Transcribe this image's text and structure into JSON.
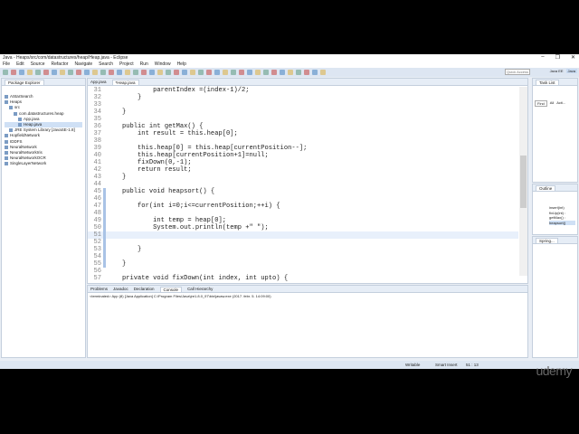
{
  "window": {
    "title": "Java - Heaps/src/com/datastructures/heap/Heap.java - Eclipse",
    "controls": [
      "–",
      "❐",
      "✕"
    ]
  },
  "menu": [
    "File",
    "Edit",
    "Source",
    "Refactor",
    "Navigate",
    "Search",
    "Project",
    "Run",
    "Window",
    "Help"
  ],
  "toolbar": {
    "quick_access": "Quick Access",
    "perspectives": [
      "Java EE",
      "Java"
    ]
  },
  "package_explorer": {
    "title": "Package Explorer",
    "items": [
      {
        "label": "AStarSearch",
        "level": 0
      },
      {
        "label": "Heaps",
        "level": 0
      },
      {
        "label": "src",
        "level": 1
      },
      {
        "label": "com.datastructures.heap",
        "level": 2
      },
      {
        "label": "App.java",
        "level": 3
      },
      {
        "label": "Heap.java",
        "level": 3
      },
      {
        "label": "JRE System Library [JavaSE-1.8]",
        "level": 1
      },
      {
        "label": "HopfieldNetwork",
        "level": 0
      },
      {
        "label": "IDDFS",
        "level": 0
      },
      {
        "label": "NeuralNetwork",
        "level": 0
      },
      {
        "label": "NeuralNetworkIris",
        "level": 0
      },
      {
        "label": "NeuralNetworkOCR",
        "level": 0
      },
      {
        "label": "SingleLayerNetwork",
        "level": 0
      }
    ]
  },
  "editor": {
    "tabs": [
      "App.java",
      "*Heap.java"
    ],
    "lines": [
      {
        "n": "31",
        "text": "            parentIndex =(index-1)/2;"
      },
      {
        "n": "32",
        "text": "        }"
      },
      {
        "n": "33",
        "text": ""
      },
      {
        "n": "34",
        "text": "    }"
      },
      {
        "n": "35",
        "text": ""
      },
      {
        "n": "36",
        "text": "    public int getMax() {"
      },
      {
        "n": "37",
        "text": "        int result = this.heap[0];"
      },
      {
        "n": "38",
        "text": ""
      },
      {
        "n": "39",
        "text": "        this.heap[0] = this.heap[currentPosition--];"
      },
      {
        "n": "40",
        "text": "        this.heap[currentPosition+1]=null;"
      },
      {
        "n": "41",
        "text": "        fixDown(0,-1);"
      },
      {
        "n": "42",
        "text": "        return result;"
      },
      {
        "n": "43",
        "text": "    }"
      },
      {
        "n": "44",
        "text": ""
      },
      {
        "n": "45",
        "text": "    public void heapsort() {"
      },
      {
        "n": "46",
        "text": ""
      },
      {
        "n": "47",
        "text": "        for(int i=0;i<=currentPosition;++i) {"
      },
      {
        "n": "48",
        "text": ""
      },
      {
        "n": "49",
        "text": "            int temp = heap[0];"
      },
      {
        "n": "50",
        "text": "            System.out.println(temp +\" \");"
      },
      {
        "n": "51",
        "text": "            "
      },
      {
        "n": "52",
        "text": ""
      },
      {
        "n": "53",
        "text": "        }"
      },
      {
        "n": "54",
        "text": ""
      },
      {
        "n": "55",
        "text": "    }"
      },
      {
        "n": "56",
        "text": ""
      },
      {
        "n": "57",
        "text": "    private void fixDown(int index, int upto) {"
      }
    ]
  },
  "task_list": {
    "title": "Task List",
    "find": "Find",
    "all": "All",
    "act": "Acti..."
  },
  "outline": {
    "title": "Outline",
    "items": [
      "insert(int)",
      "fixUp(int) :",
      "getMax() :",
      "heapsort()"
    ]
  },
  "spring": {
    "title": "Spring..."
  },
  "bottom": {
    "tabs": [
      "Problems",
      "Javadoc",
      "Declaration",
      "Console",
      "Call Hierarchy"
    ],
    "console_line": "<terminated> App (8) [Java Application] C:\\Program Files\\Java\\jre1.8.0_97\\bin\\javaw.exe (2017. febr. 5. 14:09:00)"
  },
  "status": {
    "writable": "Writable",
    "insert": "Smart Insert",
    "pos": "51 : 13"
  },
  "watermark": "udemy"
}
